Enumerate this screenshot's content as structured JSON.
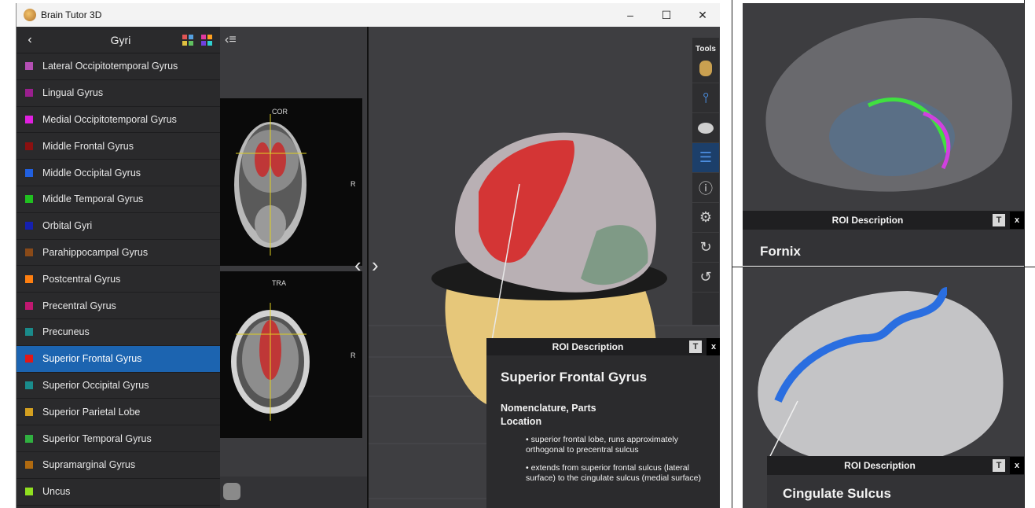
{
  "window": {
    "title": "Brain Tutor 3D",
    "controls": [
      "–",
      "☐",
      "✕"
    ]
  },
  "sidebar": {
    "back_icon": "chevron-left-icon",
    "title": "Gyri",
    "items": [
      {
        "label": "Lateral Occipitotemporal Gyrus",
        "color": "#b44fb4"
      },
      {
        "label": "Lingual Gyrus",
        "color": "#9a1f8e"
      },
      {
        "label": "Medial Occipitotemporal Gyrus",
        "color": "#e020e0"
      },
      {
        "label": "Middle Frontal Gyrus",
        "color": "#8b1010"
      },
      {
        "label": "Middle Occipital Gyrus",
        "color": "#2160e0"
      },
      {
        "label": "Middle Temporal Gyrus",
        "color": "#20c020"
      },
      {
        "label": "Orbital Gyri",
        "color": "#1520b0"
      },
      {
        "label": "Parahippocampal Gyrus",
        "color": "#8a4a18"
      },
      {
        "label": "Postcentral Gyrus",
        "color": "#ff7f10"
      },
      {
        "label": "Precentral Gyrus",
        "color": "#c01870"
      },
      {
        "label": "Precuneus",
        "color": "#1a8a8a"
      },
      {
        "label": "Superior Frontal Gyrus",
        "color": "#e01818",
        "selected": true
      },
      {
        "label": "Superior Occipital Gyrus",
        "color": "#1a8c8c"
      },
      {
        "label": "Superior Parietal Lobe",
        "color": "#d4a020"
      },
      {
        "label": "Superior Temporal Gyrus",
        "color": "#30b040"
      },
      {
        "label": "Supramarginal Gyrus",
        "color": "#b06a10"
      },
      {
        "label": "Uncus",
        "color": "#90e020"
      }
    ]
  },
  "slices": {
    "menu_icon": "collapse-menu-icon",
    "coronal_label": "COR",
    "axial_label": "TRA",
    "right_marker": "R",
    "prev": "‹",
    "next": "›"
  },
  "tools": {
    "label": "Tools",
    "items": [
      "head-model-icon",
      "sliders-icon",
      "brain-icon",
      "list-icon",
      "info-icon",
      "settings-icon",
      "rotate-right-icon",
      "rotate-left-icon"
    ],
    "glyphs": [
      "",
      "⫯",
      "",
      "☰",
      "ⓘ",
      "⚙",
      "↻",
      "↺"
    ]
  },
  "roi_main": {
    "header": "ROI Description",
    "t_btn": "T",
    "x_btn": "x",
    "name": "Superior Frontal Gyrus",
    "section_1": "Nomenclature, Parts",
    "section_2": "Location",
    "bullets": [
      "superior frontal lobe, runs approximately orthogonal to precentral sulcus",
      "extends from superior frontal sulcus (lateral surface) to the cingulate sulcus (medial surface)"
    ]
  },
  "roi_fornix": {
    "header": "ROI Description",
    "t_btn": "T",
    "x_btn": "x",
    "name": "Fornix"
  },
  "roi_cingulate": {
    "header": "ROI Description",
    "t_btn": "T",
    "x_btn": "x",
    "name": "Cingulate Sulcus"
  }
}
